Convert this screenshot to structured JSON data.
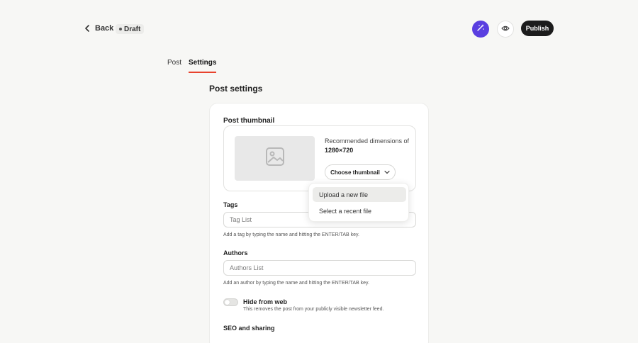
{
  "header": {
    "back_label": "Back",
    "draft_label": "Draft",
    "publish_label": "Publish"
  },
  "tabs": [
    {
      "label": "Post",
      "active": false
    },
    {
      "label": "Settings",
      "active": true
    }
  ],
  "settings": {
    "title": "Post settings",
    "thumbnail": {
      "title": "Post thumbnail",
      "recommended_text": "Recommended dimensions of",
      "dimensions": "1280×720",
      "choose_label": "Choose thumbnail",
      "dropdown": [
        "Upload a new file",
        "Select a recent file"
      ]
    },
    "tags": {
      "label": "Tags",
      "placeholder": "Tag List",
      "help": "Add a tag by typing the name and hitting the ENTER/TAB key."
    },
    "authors": {
      "label": "Authors",
      "placeholder": "Authors List",
      "help": "Add an author by typing the name and hitting the ENTER/TAB key."
    },
    "hide_web": {
      "title": "Hide from web",
      "desc": "This removes the post from your publicly visible newsletter feed.",
      "enabled": false
    },
    "seo_title": "SEO and sharing"
  },
  "icons": {
    "back": "chevron-left-icon",
    "ai": "wand-icon",
    "preview": "eye-icon",
    "image": "image-placeholder-icon",
    "dropdown": "chevron-down-icon"
  },
  "colors": {
    "accent": "#e8432d",
    "ai_button": "#5a3fe0",
    "publish_button": "#1c1c1c",
    "background": "#f7f7f5"
  }
}
